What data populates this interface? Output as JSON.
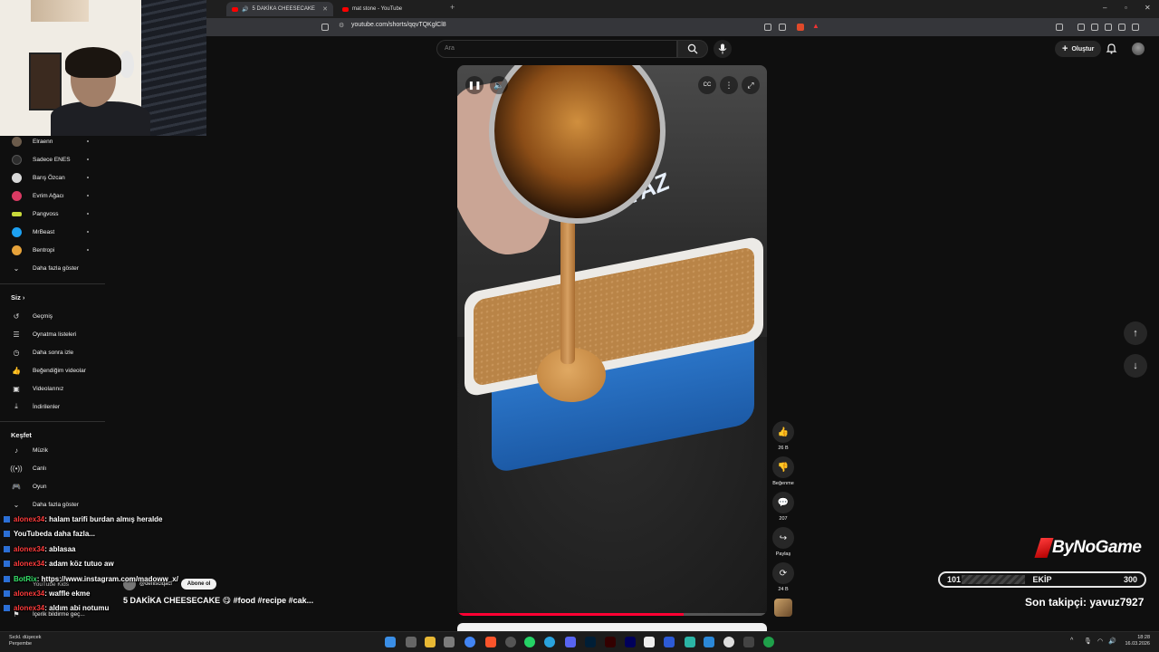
{
  "browser": {
    "tabs": [
      {
        "label": "5 DAKİKA CHEESECAKE",
        "active": true
      },
      {
        "label": "mat stone - YouTube",
        "active": false
      }
    ],
    "url": "youtube.com/shorts/qqvTQKglCl8"
  },
  "youtube": {
    "search_placeholder": "Ara",
    "create_label": "Oluştur"
  },
  "sidebar": {
    "subscriptions": [
      {
        "label": "Elraenn",
        "color": "#6b5b4b"
      },
      {
        "label": "Sadece ENES",
        "color": "#2d2d2d"
      },
      {
        "label": "Barış Özcan",
        "color": "#d9d9d9"
      },
      {
        "label": "Evrim Ağacı",
        "color": "#d93a63"
      },
      {
        "label": "Pangvoss",
        "color": "#c8d93a"
      },
      {
        "label": "MrBeast",
        "color": "#1da1f2"
      },
      {
        "label": "Bentropi",
        "color": "#e6a23a"
      }
    ],
    "show_more": "Daha fazla göster",
    "you_title": "Siz",
    "you_items": [
      {
        "label": "Geçmiş",
        "icon": "history-icon"
      },
      {
        "label": "Oynatma listeleri",
        "icon": "playlists-icon"
      },
      {
        "label": "Daha sonra izle",
        "icon": "clock-icon"
      },
      {
        "label": "Beğendiğim videolar",
        "icon": "thumb-up-icon"
      },
      {
        "label": "Videolarınız",
        "icon": "video-icon"
      },
      {
        "label": "İndirilenler",
        "icon": "download-icon"
      }
    ],
    "explore_title": "Keşfet",
    "explore_items": [
      {
        "label": "Müzik",
        "icon": "music-icon"
      },
      {
        "label": "Canlı",
        "icon": "live-icon"
      },
      {
        "label": "Oyun",
        "icon": "gaming-icon"
      }
    ],
    "explore_more": "Daha fazla göster",
    "bottom_items": [
      "YouTube Kids",
      "İçerik bildirme geç..."
    ]
  },
  "short": {
    "likes": "26 B",
    "dislike_label": "Beğenme",
    "comments": "207",
    "share_label": "Paylaş",
    "remix": "24 B",
    "author": "@denisciqaci",
    "subscribe_label": "Abone ol",
    "title": "5 DAKİKA CHEESECAKE 😋 #food #recipe #cak...",
    "progress": 0.73
  },
  "chat": [
    {
      "user": "alonex34",
      "msg": ": halam tarifi burdan almış heralde",
      "bot": false
    },
    {
      "user": "YouTube",
      "msg": "da daha fazla...",
      "bot": false
    },
    {
      "user": "alonex34",
      "msg": ": ablasaa",
      "bot": false
    },
    {
      "user": "alonex34",
      "msg": ": adam köz tutuo aw",
      "bot": false
    },
    {
      "user": "BotRix",
      "msg": ": https://www.instagram.com/madoww_x/",
      "bot": true
    },
    {
      "user": "alonex34",
      "msg": ": waffle ekme",
      "bot": false
    },
    {
      "user": "alonex34",
      "msg": ": aldım abi notumu",
      "bot": false
    }
  ],
  "overlay": {
    "brand": "ByNoGame",
    "goal_min": "101",
    "goal_label": "EKİP",
    "goal_max": "300",
    "goal_fraction": 0.4,
    "last_follower": "Son takipçi: yavuz7927"
  },
  "taskbar": {
    "weather_line1": "Sıckl. düşecek",
    "weather_line2": "Perşembe",
    "time": "18:28",
    "date": "16.03.2026"
  }
}
